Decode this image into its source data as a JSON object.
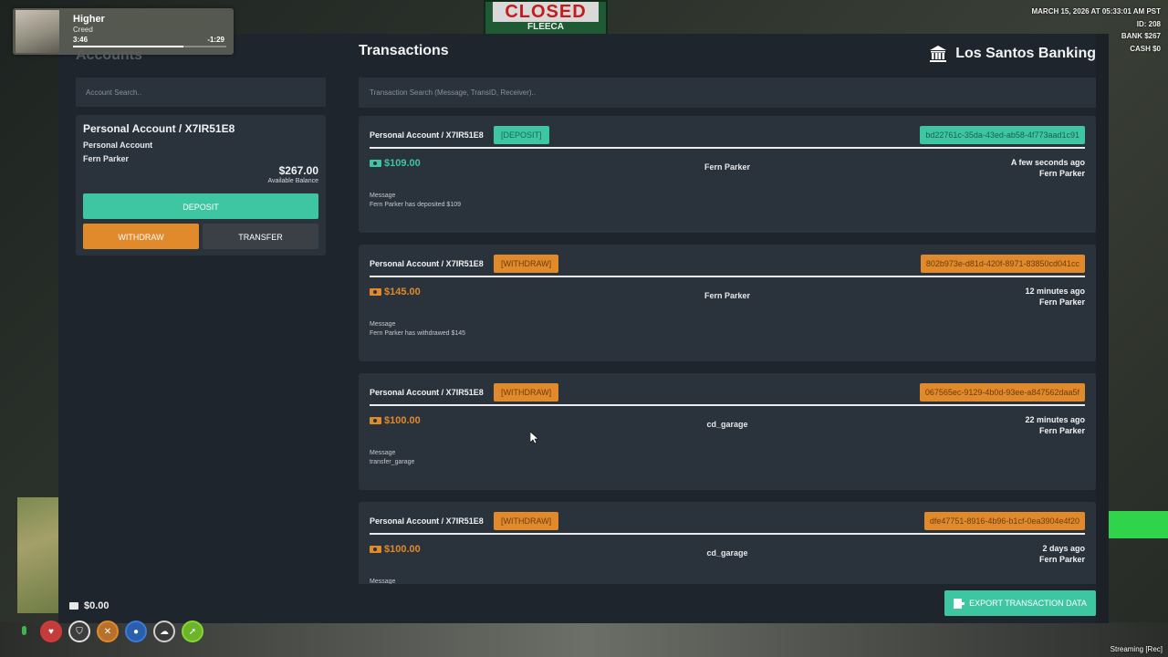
{
  "background": {
    "sign_text": "CLOSED",
    "sign_subtext": "FLEECA"
  },
  "hud_top_right": {
    "datetime": "MARCH 15, 2026 AT 05:33:01 AM PST",
    "id": "ID: 208",
    "bank": "BANK $267",
    "cash": "CASH $0"
  },
  "music": {
    "song": "Higher",
    "artist": "Creed",
    "elapsed": "3:46",
    "remaining": "-1:29",
    "progress_fraction": 0.72
  },
  "accounts": {
    "title": "Accounts",
    "search_placeholder": "Account Search..",
    "card": {
      "name": "Personal Account / X7IR51E8",
      "type": "Personal Account",
      "holder": "Fern Parker",
      "balance": "$267.00",
      "balance_label": "Available Balance",
      "deposit_label": "DEPOSIT",
      "withdraw_label": "WITHDRAW",
      "transfer_label": "TRANSFER"
    },
    "wallet": "$0.00"
  },
  "transactions": {
    "title": "Transactions",
    "bank_name": "Los Santos Banking",
    "search_placeholder": "Transaction Search (Message, TransID, Receiver)..",
    "message_label": "Message",
    "items": [
      {
        "account": "Personal Account / X7IR51E8",
        "type_label": "[DEPOSIT]",
        "kind": "dep",
        "trans_id": "bd22761c-35da-43ed-ab58-4f773aad1c91",
        "amount": "$109.00",
        "receiver": "Fern Parker",
        "time": "A few seconds ago",
        "by": "Fern Parker",
        "message": "Fern Parker has deposited $109"
      },
      {
        "account": "Personal Account / X7IR51E8",
        "type_label": "[WITHDRAW]",
        "kind": "wd",
        "trans_id": "802b973e-d81d-420f-8971-83850cd041cc",
        "amount": "$145.00",
        "receiver": "Fern Parker",
        "time": "12 minutes ago",
        "by": "Fern Parker",
        "message": "Fern Parker has withdrawed $145"
      },
      {
        "account": "Personal Account / X7IR51E8",
        "type_label": "[WITHDRAW]",
        "kind": "wd",
        "trans_id": "067565ec-9129-4b0d-93ee-a847562daa5f",
        "amount": "$100.00",
        "receiver": "cd_garage",
        "time": "22 minutes ago",
        "by": "Fern Parker",
        "message": "transfer_garage"
      },
      {
        "account": "Personal Account / X7IR51E8",
        "type_label": "[WITHDRAW]",
        "kind": "wd",
        "trans_id": "dfe47751-8916-4b96-b1cf-0ea3904e4f20",
        "amount": "$100.00",
        "receiver": "cd_garage",
        "time": "2 days ago",
        "by": "Fern Parker",
        "message": ""
      }
    ],
    "export_label": "EXPORT TRANSACTION DATA"
  },
  "status_icons": [
    "heart-icon",
    "armor-icon",
    "food-icon",
    "water-icon",
    "stress-icon",
    "stamina-icon"
  ],
  "colors": {
    "panel_bg": "#1e252d",
    "card_bg": "#2a323b",
    "deposit_green": "#3ec6a3",
    "withdraw_orange": "#e08a2c",
    "neutral_button": "#3b4047"
  },
  "watermark": "Streaming [Rec]"
}
